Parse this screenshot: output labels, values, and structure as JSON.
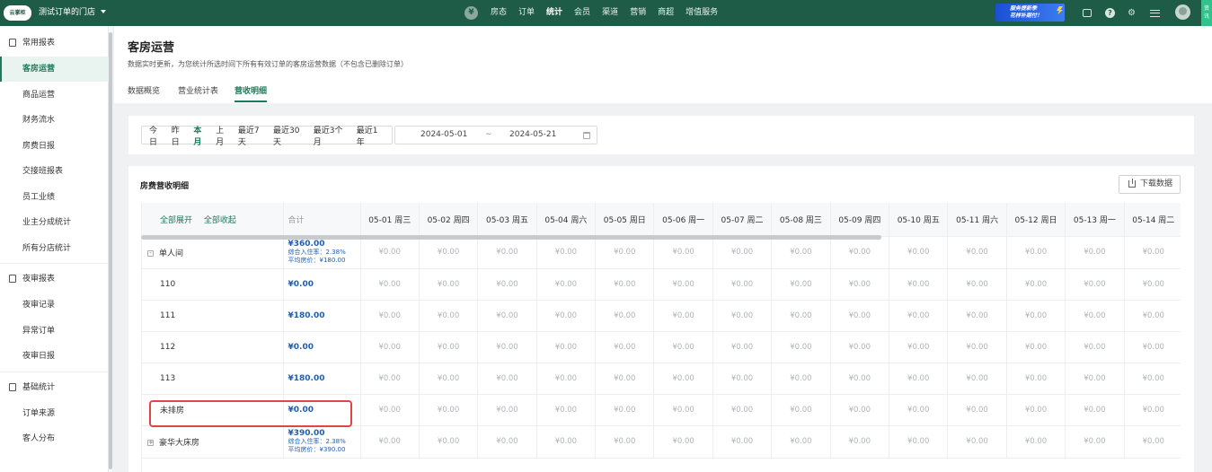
{
  "topbar": {
    "logo_text": "云掌柜",
    "store_name": "测试订单的门店",
    "nav_currency_icon": "¥",
    "nav": [
      "房态",
      "订单",
      "统计",
      "会员",
      "渠道",
      "营销",
      "商超",
      "增值服务"
    ],
    "nav_active_index": 2,
    "promo_line1": "服务提新季",
    "promo_line2": "花样补期付！",
    "side_tab": "资\n讯",
    "brand_color": "#1f5c48",
    "accent_color": "#1f7a59"
  },
  "sidebar": {
    "groups": [
      {
        "label": "常用报表",
        "icon": "report-icon",
        "items": [
          "客房运营",
          "商品运营",
          "财务流水",
          "房费日报",
          "交接班报表",
          "员工业绩",
          "业主分成统计",
          "所有分店统计"
        ]
      },
      {
        "label": "夜审报表",
        "icon": "night-audit-icon",
        "items": [
          "夜审记录",
          "异常订单",
          "夜审日报"
        ]
      },
      {
        "label": "基础统计",
        "icon": "chart-icon",
        "items": [
          "订单来源",
          "客人分布"
        ]
      }
    ],
    "active_item": "客房运营"
  },
  "page": {
    "title": "客房运营",
    "description": "数据实时更新，为您统计所选时间下所有有效订单的客房运营数据（不包含已删除订单）",
    "tabs": [
      "数据概览",
      "营业统计表",
      "营收明细"
    ],
    "active_tab": "营收明细"
  },
  "filters": {
    "quick_ranges": [
      "今日",
      "昨日",
      "本月",
      "上月",
      "最近7天",
      "最近30天",
      "最近3个月",
      "最近1年"
    ],
    "active_range": "本月",
    "start_date": "2024-05-01",
    "separator": "~",
    "end_date": "2024-05-21"
  },
  "table": {
    "title": "房费营收明细",
    "download_label": "下载数据",
    "expand_all": "全部展开",
    "collapse_all": "全部收起",
    "total_header": "合计",
    "date_headers": [
      "05-01 周三",
      "05-02 周四",
      "05-03 周五",
      "05-04 周六",
      "05-05 周日",
      "05-06 周一",
      "05-07 周二",
      "05-08 周三",
      "05-09 周四",
      "05-10 周五",
      "05-11 周六",
      "05-12 周日",
      "05-13 周一",
      "05-14 周二"
    ],
    "cell_value": "¥0.00",
    "rows": [
      {
        "type": "group",
        "name": "单人间",
        "toggle": "-",
        "total": "¥360.00",
        "occupancy": "综合入住率：2.38%",
        "avg_price": "平均房价：¥180.00"
      },
      {
        "type": "room",
        "name": "110",
        "total": "¥0.00"
      },
      {
        "type": "room",
        "name": "111",
        "total": "¥180.00"
      },
      {
        "type": "room",
        "name": "112",
        "total": "¥0.00"
      },
      {
        "type": "room",
        "name": "113",
        "total": "¥180.00"
      },
      {
        "type": "room",
        "name": "未排房",
        "total": "¥0.00",
        "highlighted": true
      },
      {
        "type": "group",
        "name": "豪华大床房",
        "toggle": "+",
        "total": "¥390.00",
        "occupancy": "综合入住率：2.38%",
        "avg_price": "平均房价：¥390.00"
      }
    ]
  }
}
